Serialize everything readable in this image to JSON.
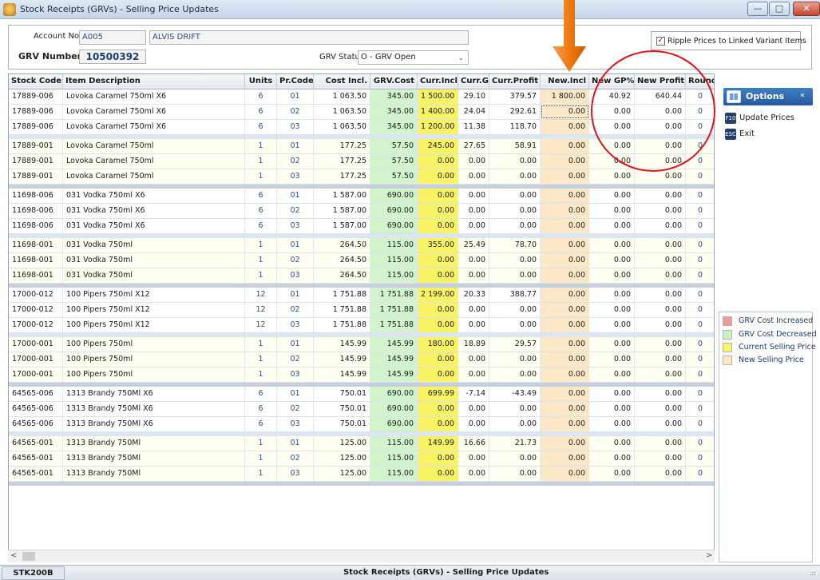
{
  "window": {
    "title": "Stock Receipts (GRVs) - Selling Price Updates",
    "min": "—",
    "max": "□",
    "close": "✕"
  },
  "header": {
    "account_label": "Account No.",
    "account_no": "A005",
    "account_name": "ALVIS DRIFT",
    "grv_number_label": "GRV Number",
    "grv_number": "10500392",
    "grv_status_label": "GRV Status",
    "grv_status": "O - GRV Open",
    "ripple_label": "Ripple Prices to Linked Variant Items",
    "ripple_checked": "✓"
  },
  "grid": {
    "columns": [
      "Stock Code",
      "Item Description",
      "Units",
      "Pr.Code",
      "Cost Incl.",
      "GRV.Cost",
      "Curr.Incl",
      "Curr.GP.",
      "Curr.Profit",
      "New.Incl",
      "New GP%",
      "New Profit",
      "Roundi"
    ],
    "groups": [
      [
        [
          "17889-006",
          "Lovoka Caramel 750ml X6",
          "6",
          "01",
          "1 063.50",
          "345.00",
          "1 500.00",
          "29.10",
          "379.57",
          "1 800.00",
          "40.92",
          "640.44",
          "0"
        ],
        [
          "17889-006",
          "Lovoka Caramel 750ml X6",
          "6",
          "02",
          "1 063.50",
          "345.00",
          "1 400.00",
          "24.04",
          "292.61",
          "0.00",
          "0.00",
          "0.00",
          "0"
        ],
        [
          "17889-006",
          "Lovoka Caramel 750ml X6",
          "6",
          "03",
          "1 063.50",
          "345.00",
          "1 200.00",
          "11.38",
          "118.70",
          "0.00",
          "0.00",
          "0.00",
          "0"
        ]
      ],
      [
        [
          "17889-001",
          "Lovoka Caramel 750ml",
          "1",
          "01",
          "177.25",
          "57.50",
          "245.00",
          "27.65",
          "58.91",
          "0.00",
          "0.00",
          "0.00",
          "0"
        ],
        [
          "17889-001",
          "Lovoka Caramel 750ml",
          "1",
          "02",
          "177.25",
          "57.50",
          "0.00",
          "0.00",
          "0.00",
          "0.00",
          "0.00",
          "0.00",
          "0"
        ],
        [
          "17889-001",
          "Lovoka Caramel 750ml",
          "1",
          "03",
          "177.25",
          "57.50",
          "0.00",
          "0.00",
          "0.00",
          "0.00",
          "0.00",
          "0.00",
          "0"
        ]
      ],
      [
        [
          "11698-006",
          "031 Vodka 750ml X6",
          "6",
          "01",
          "1 587.00",
          "690.00",
          "0.00",
          "0.00",
          "0.00",
          "0.00",
          "0.00",
          "0.00",
          "0"
        ],
        [
          "11698-006",
          "031 Vodka 750ml X6",
          "6",
          "02",
          "1 587.00",
          "690.00",
          "0.00",
          "0.00",
          "0.00",
          "0.00",
          "0.00",
          "0.00",
          "0"
        ],
        [
          "11698-006",
          "031 Vodka 750ml X6",
          "6",
          "03",
          "1 587.00",
          "690.00",
          "0.00",
          "0.00",
          "0.00",
          "0.00",
          "0.00",
          "0.00",
          "0"
        ]
      ],
      [
        [
          "11698-001",
          "031 Vodka 750ml",
          "1",
          "01",
          "264.50",
          "115.00",
          "355.00",
          "25.49",
          "78.70",
          "0.00",
          "0.00",
          "0.00",
          "0"
        ],
        [
          "11698-001",
          "031 Vodka 750ml",
          "1",
          "02",
          "264.50",
          "115.00",
          "0.00",
          "0.00",
          "0.00",
          "0.00",
          "0.00",
          "0.00",
          "0"
        ],
        [
          "11698-001",
          "031 Vodka 750ml",
          "1",
          "03",
          "264.50",
          "115.00",
          "0.00",
          "0.00",
          "0.00",
          "0.00",
          "0.00",
          "0.00",
          "0"
        ]
      ],
      [
        [
          "17000-012",
          "100 Pipers 750ml X12",
          "12",
          "01",
          "1 751.88",
          "1 751.88",
          "2 199.00",
          "20.33",
          "388.77",
          "0.00",
          "0.00",
          "0.00",
          "0"
        ],
        [
          "17000-012",
          "100 Pipers 750ml X12",
          "12",
          "02",
          "1 751.88",
          "1 751.88",
          "0.00",
          "0.00",
          "0.00",
          "0.00",
          "0.00",
          "0.00",
          "0"
        ],
        [
          "17000-012",
          "100 Pipers 750ml X12",
          "12",
          "03",
          "1 751.88",
          "1 751.88",
          "0.00",
          "0.00",
          "0.00",
          "0.00",
          "0.00",
          "0.00",
          "0"
        ]
      ],
      [
        [
          "17000-001",
          "100 Pipers 750ml",
          "1",
          "01",
          "145.99",
          "145.99",
          "180.00",
          "18.89",
          "29.57",
          "0.00",
          "0.00",
          "0.00",
          "0"
        ],
        [
          "17000-001",
          "100 Pipers 750ml",
          "1",
          "02",
          "145.99",
          "145.99",
          "0.00",
          "0.00",
          "0.00",
          "0.00",
          "0.00",
          "0.00",
          "0"
        ],
        [
          "17000-001",
          "100 Pipers 750ml",
          "1",
          "03",
          "145.99",
          "145.99",
          "0.00",
          "0.00",
          "0.00",
          "0.00",
          "0.00",
          "0.00",
          "0"
        ]
      ],
      [
        [
          "64565-006",
          "1313 Brandy 750Ml X6",
          "6",
          "01",
          "750.01",
          "690.00",
          "699.99",
          "-7.14",
          "-43.49",
          "0.00",
          "0.00",
          "0.00",
          "0"
        ],
        [
          "64565-006",
          "1313 Brandy 750Ml X6",
          "6",
          "02",
          "750.01",
          "690.00",
          "0.00",
          "0.00",
          "0.00",
          "0.00",
          "0.00",
          "0.00",
          "0"
        ],
        [
          "64565-006",
          "1313 Brandy 750Ml X6",
          "6",
          "03",
          "750.01",
          "690.00",
          "0.00",
          "0.00",
          "0.00",
          "0.00",
          "0.00",
          "0.00",
          "0"
        ]
      ],
      [
        [
          "64565-001",
          "1313 Brandy 750Ml",
          "1",
          "01",
          "125.00",
          "115.00",
          "149.99",
          "16.66",
          "21.73",
          "0.00",
          "0.00",
          "0.00",
          "0"
        ],
        [
          "64565-001",
          "1313 Brandy 750Ml",
          "1",
          "02",
          "125.00",
          "115.00",
          "0.00",
          "0.00",
          "0.00",
          "0.00",
          "0.00",
          "0.00",
          "0"
        ],
        [
          "64565-001",
          "1313 Brandy 750Ml",
          "1",
          "03",
          "125.00",
          "115.00",
          "0.00",
          "0.00",
          "0.00",
          "0.00",
          "0.00",
          "0.00",
          "0"
        ]
      ]
    ],
    "selected_cell": {
      "group": 0,
      "row": 1,
      "col": 9
    }
  },
  "options": {
    "title": "Options",
    "collapse": "«",
    "items": [
      {
        "key": "F10",
        "label": "Update Prices"
      },
      {
        "key": "ESC",
        "label": "Exit"
      }
    ]
  },
  "legend": [
    {
      "label": "GRV Cost Increased",
      "color": "#f29a9a"
    },
    {
      "label": "GRV Cost Decreased",
      "color": "#c8f2c2"
    },
    {
      "label": "Current Selling Price",
      "color": "#f9f56b"
    },
    {
      "label": "New Selling Price",
      "color": "#fbe9c6"
    }
  ],
  "colors": {
    "grv_cost": "#d2f4cc",
    "curr_incl": "#f8f365",
    "new_incl": "#fce8c7",
    "annotation_red": "#e3111a",
    "annotation_orange": "#ee7a12"
  },
  "status": {
    "code": "STK200B",
    "title": "Stock Receipts (GRVs) - Selling Price Updates",
    "grip": ".::"
  },
  "scroll": {
    "left": "<",
    "right": ">"
  }
}
